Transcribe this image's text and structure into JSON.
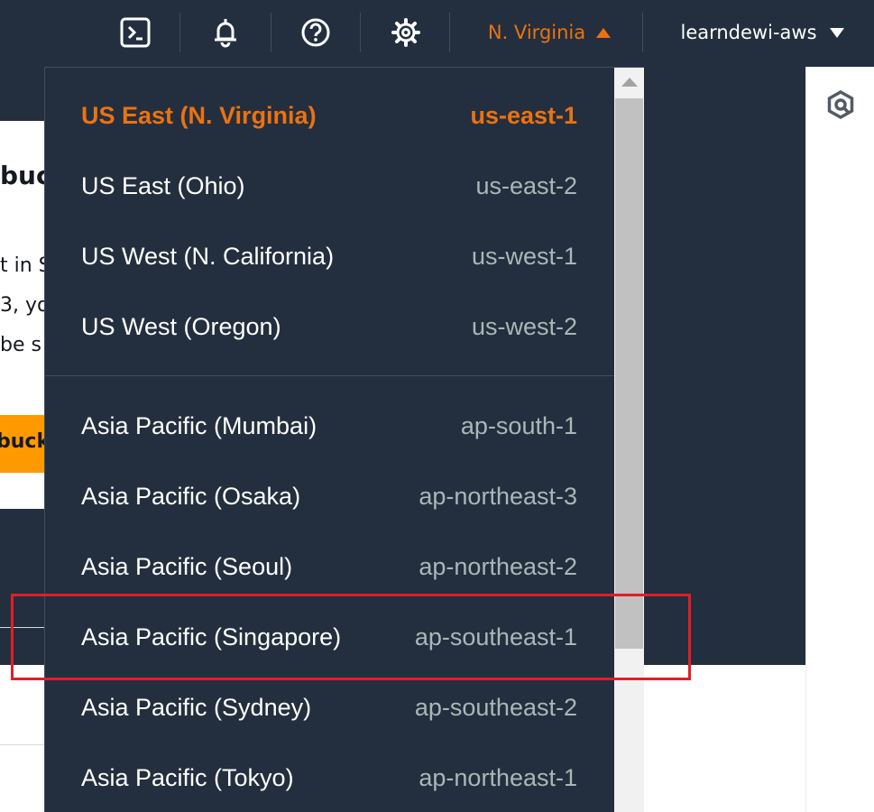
{
  "topbar": {
    "icons": [
      "cloudshell-icon",
      "bell-icon",
      "help-icon",
      "gear-icon"
    ],
    "region_label": "N. Virginia",
    "account_label": "learndewi-aws",
    "region_color": "#ec7211"
  },
  "background_page": {
    "heading_fragment": "buc",
    "lines": [
      "t in S",
      "3, yo",
      "be s"
    ],
    "button_fragment": "buck"
  },
  "region_menu": {
    "groups": [
      [
        {
          "name": "US East (N. Virginia)",
          "code": "us-east-1",
          "selected": true
        },
        {
          "name": "US East (Ohio)",
          "code": "us-east-2"
        },
        {
          "name": "US West (N. California)",
          "code": "us-west-1"
        },
        {
          "name": "US West (Oregon)",
          "code": "us-west-2"
        }
      ],
      [
        {
          "name": "Asia Pacific (Mumbai)",
          "code": "ap-south-1"
        },
        {
          "name": "Asia Pacific (Osaka)",
          "code": "ap-northeast-3"
        },
        {
          "name": "Asia Pacific (Seoul)",
          "code": "ap-northeast-2"
        },
        {
          "name": "Asia Pacific (Singapore)",
          "code": "ap-southeast-1"
        },
        {
          "name": "Asia Pacific (Sydney)",
          "code": "ap-southeast-2"
        },
        {
          "name": "Asia Pacific (Tokyo)",
          "code": "ap-northeast-1"
        }
      ]
    ]
  }
}
